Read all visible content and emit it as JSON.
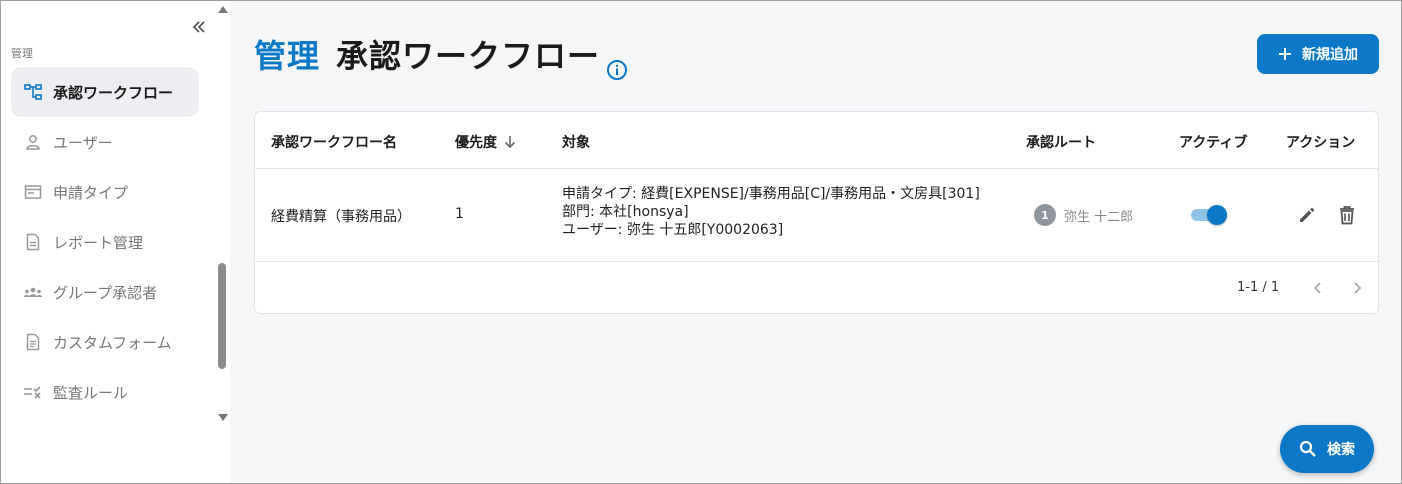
{
  "sidebar": {
    "section_label": "管理",
    "items": [
      {
        "label": "承認ワークフロー",
        "icon": "workflow-icon",
        "active": true
      },
      {
        "label": "ユーザー",
        "icon": "user-icon",
        "active": false
      },
      {
        "label": "申請タイプ",
        "icon": "request-type-icon",
        "active": false
      },
      {
        "label": "レポート管理",
        "icon": "report-icon",
        "active": false
      },
      {
        "label": "グループ承認者",
        "icon": "group-icon",
        "active": false
      },
      {
        "label": "カスタムフォーム",
        "icon": "form-icon",
        "active": false
      },
      {
        "label": "監査ルール",
        "icon": "audit-rule-icon",
        "active": false
      }
    ]
  },
  "header": {
    "breadcrumb": "管理",
    "title": "承認ワークフロー",
    "add_button": "新規追加"
  },
  "table": {
    "columns": {
      "name": "承認ワークフロー名",
      "priority": "優先度",
      "target": "対象",
      "route": "承認ルート",
      "active": "アクティブ",
      "action": "アクション"
    },
    "rows": [
      {
        "name": "経費精算（事務用品）",
        "priority": "1",
        "target_lines": [
          "申請タイプ: 経費[EXPENSE]/事務用品[C]/事務用品・文房具[301]",
          "部門: 本社[honsya]",
          "ユーザー: 弥生 十五郎[Y0002063]"
        ],
        "route_step": "1",
        "route_name": "弥生 十二郎",
        "active": true
      }
    ]
  },
  "pagination": {
    "range": "1-1 / 1"
  },
  "search_button": "検索",
  "colors": {
    "accent": "#0b79c8",
    "background": "#f4f6f8"
  }
}
